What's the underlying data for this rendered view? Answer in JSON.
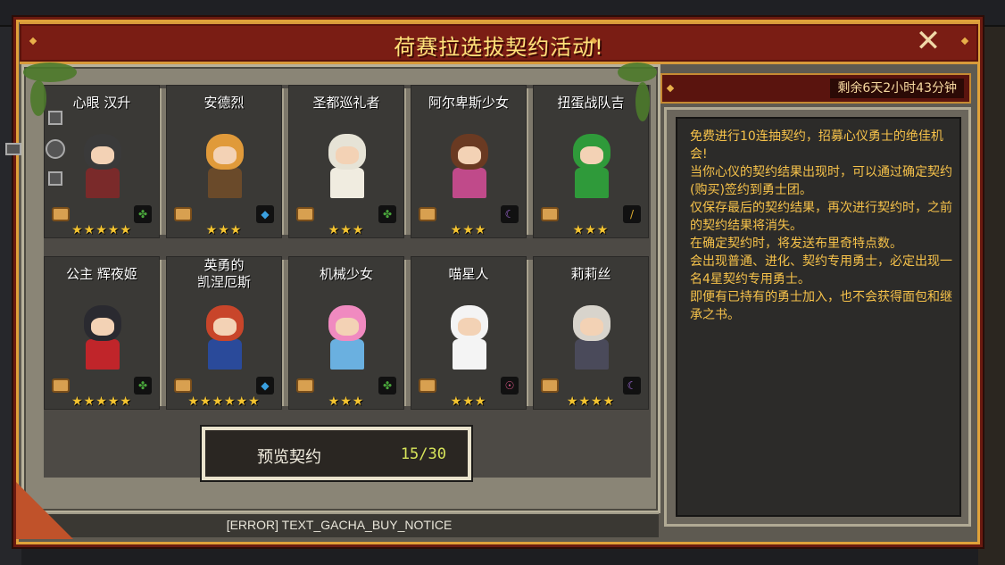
{
  "dialog": {
    "title": "荷赛拉选拔契约活动!",
    "close_glyph": "✕"
  },
  "timer": {
    "text": "剩余6天2小时43分钟"
  },
  "cards": [
    {
      "name": "心眼 汉升",
      "stars": "★★★★★",
      "element_icon": "leaf-icon",
      "element_glyph": "✤",
      "element_color": "#49a53b",
      "hair": "#3a3a3a",
      "outfit": "#7a2a2a"
    },
    {
      "name": "安德烈",
      "stars": "★★★",
      "element_icon": "water-icon",
      "element_glyph": "◆",
      "element_color": "#3aa0e0",
      "hair": "#e09a3a",
      "outfit": "#6a4a2a"
    },
    {
      "name": "圣都巡礼者",
      "stars": "★★★",
      "element_icon": "leaf-icon",
      "element_glyph": "✤",
      "element_color": "#49a53b",
      "hair": "#e6e3d6",
      "outfit": "#f0ece0"
    },
    {
      "name": "阿尔卑斯少女",
      "stars": "★★★",
      "element_icon": "dark-icon",
      "element_glyph": "☾",
      "element_color": "#a06ad8",
      "hair": "#6a3a22",
      "outfit": "#c04a8a"
    },
    {
      "name": "扭蛋战队吉",
      "stars": "★★★",
      "element_icon": "earth-icon",
      "element_glyph": "/",
      "element_color": "#e0b030",
      "hair": "#2f9a3a",
      "outfit": "#2f9a3a"
    },
    {
      "name": "公主 辉夜姬",
      "stars": "★★★★★",
      "element_icon": "leaf-icon",
      "element_glyph": "✤",
      "element_color": "#49a53b",
      "hair": "#2a2a30",
      "outfit": "#c0252a"
    },
    {
      "name": "英勇的\n凯涅厄斯",
      "stars": "★★★★★★",
      "element_icon": "water-icon",
      "element_glyph": "◆",
      "element_color": "#3aa0e0",
      "hair": "#c8452a",
      "outfit": "#2a4a9a"
    },
    {
      "name": "机械少女",
      "stars": "★★★",
      "element_icon": "leaf-icon",
      "element_glyph": "✤",
      "element_color": "#49a53b",
      "hair": "#f08ac0",
      "outfit": "#6ab0e0"
    },
    {
      "name": "喵星人",
      "stars": "★★★",
      "element_icon": "light-icon",
      "element_glyph": "☉",
      "element_color": "#e05a8a",
      "hair": "#f4f4f4",
      "outfit": "#f4f4f4"
    },
    {
      "name": "莉莉丝",
      "stars": "★★★★",
      "element_icon": "dark-icon",
      "element_glyph": "☾",
      "element_color": "#a06ad8",
      "hair": "#d8d4cc",
      "outfit": "#4a4a5a"
    }
  ],
  "preview": {
    "label": "预览契约",
    "count": "15/30"
  },
  "error_notice": "[ERROR] TEXT_GACHA_BUY_NOTICE",
  "info_text": "免费进行10连抽契约，招募心仪勇士的绝佳机会!\n当你心仪的契约结果出现时，可以通过确定契约(购买)签约到勇士团。\n仅保存最后的契约结果，再次进行契约时，之前的契约结果将消失。\n在确定契约时，将发送布里奇特点数。\n会出现普通、进化、契约专用勇士，必定出现一名4星契约专用勇士。\n即便有已持有的勇士加入，也不会获得面包和继承之书。",
  "colors": {
    "title_text": "#ffe27a",
    "info_text": "#f6c24a",
    "star": "#f4c430",
    "preview_count": "#d7e45a",
    "frame_gold": "#e0a23a"
  }
}
